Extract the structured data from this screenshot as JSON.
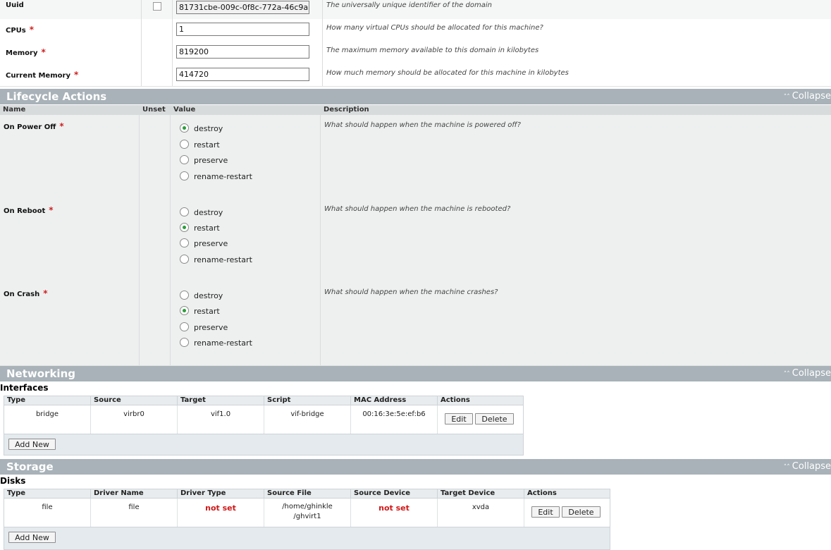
{
  "properties": [
    {
      "name": "Uuid",
      "required": false,
      "unset": true,
      "value": "81731cbe-009c-0f8c-772a-46c9a",
      "description": "The universally unique identifier of the domain"
    },
    {
      "name": "CPUs",
      "required": true,
      "unset": false,
      "value": "1",
      "description": "How many virtual CPUs should be allocated for this machine?"
    },
    {
      "name": "Memory",
      "required": true,
      "unset": false,
      "value": "819200",
      "description": "The maximum memory available to this domain in kilobytes"
    },
    {
      "name": "Current Memory",
      "required": true,
      "unset": false,
      "value": "414720",
      "description": "How much memory should be allocated for this machine in kilobytes"
    }
  ],
  "required_marker": "*",
  "collapse_label": "Collapse",
  "collapse_chevron": "˄˄",
  "lifecycle": {
    "title": "Lifecycle Actions",
    "columns": {
      "name": "Name",
      "unset": "Unset",
      "value": "Value",
      "description": "Description"
    },
    "options": [
      "destroy",
      "restart",
      "preserve",
      "rename-restart"
    ],
    "rows": [
      {
        "name": "On Power Off",
        "description": "What should happen when the machine is powered off?",
        "selected": "destroy"
      },
      {
        "name": "On Reboot",
        "description": "What should happen when the machine is rebooted?",
        "selected": "restart"
      },
      {
        "name": "On Crash",
        "description": "What should happen when the machine crashes?",
        "selected": "restart"
      }
    ]
  },
  "networking": {
    "title": "Networking",
    "subtitle": "Interfaces",
    "columns": [
      "Type",
      "Source",
      "Target",
      "Script",
      "MAC Address",
      "Actions"
    ],
    "rows": [
      {
        "type": "bridge",
        "source": "virbr0",
        "target": "vif1.0",
        "script": "vif-bridge",
        "mac": "00:16:3e:5e:ef:b6"
      }
    ],
    "edit_label": "Edit",
    "delete_label": "Delete",
    "add_label": "Add New"
  },
  "storage": {
    "title": "Storage",
    "subtitle": "Disks",
    "columns": [
      "Type",
      "Driver Name",
      "Driver Type",
      "Source File",
      "Source Device",
      "Target Device",
      "Actions"
    ],
    "rows": [
      {
        "type": "file",
        "driver_name": "file",
        "driver_type": "not set",
        "source_file_line1": "/home/ghinkle",
        "source_file_line2": "/ghvirt1",
        "source_device": "not set",
        "target_device": "xvda"
      }
    ],
    "edit_label": "Edit",
    "delete_label": "Delete",
    "add_label": "Add New"
  },
  "colors": {
    "section_header": "#a8b2b8",
    "required": "#d02020",
    "radio_selected": "#2a9c3a",
    "not_set": "#d01818"
  }
}
